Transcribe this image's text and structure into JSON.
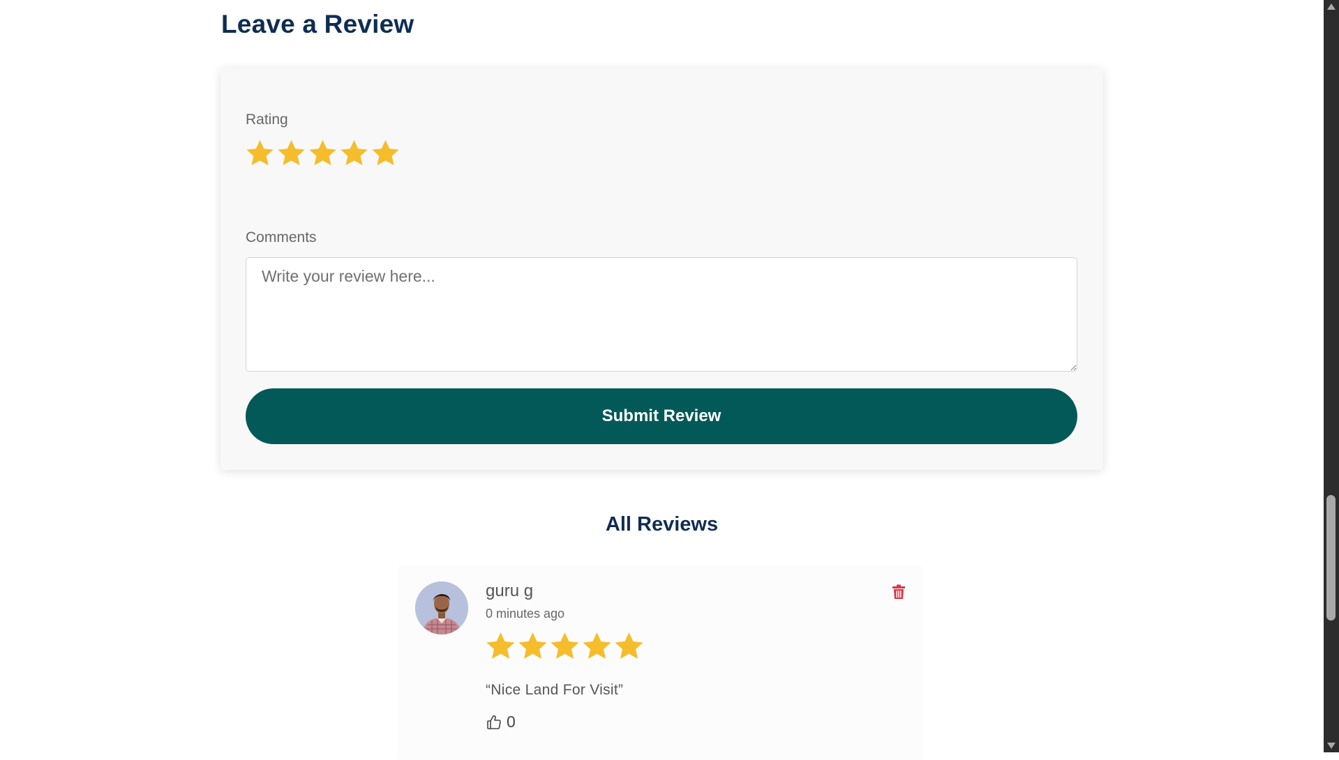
{
  "leave_review": {
    "title": "Leave a Review",
    "rating_label": "Rating",
    "rating_value": 5,
    "rating_max": 5,
    "comments_label": "Comments",
    "comments_placeholder": "Write your review here...",
    "comments_value": "",
    "submit_label": "Submit Review"
  },
  "all_reviews": {
    "title": "All Reviews",
    "items": [
      {
        "name": "guru g",
        "time": "0 minutes ago",
        "rating": 5,
        "text": "“Nice Land For Visit”",
        "likes": "0",
        "avatar_icon": "user-photo-avatar",
        "delete_icon": "trash-icon",
        "like_icon": "thumbs-up-icon"
      }
    ]
  },
  "colors": {
    "heading": "#0f2d52",
    "accent_button": "#025958",
    "star": "#f5bd2c",
    "delete": "#dc3545"
  }
}
